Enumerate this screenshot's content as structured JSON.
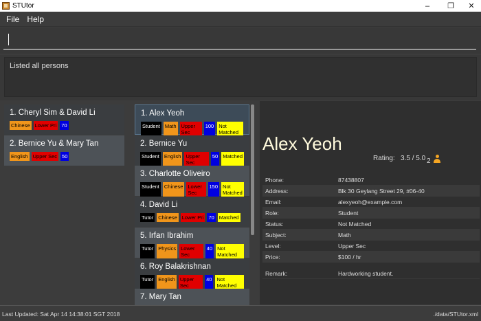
{
  "window": {
    "title": "STUtor",
    "min": "–",
    "max": "❐",
    "close": "✕"
  },
  "menu": {
    "file": "File",
    "help": "Help"
  },
  "command": {
    "value": "",
    "placeholder": ""
  },
  "result": {
    "text": "Listed all persons"
  },
  "matches": [
    {
      "index": "1.",
      "name": "Cheryl Sim & David Li",
      "tags": [
        {
          "text": "Chinese",
          "bg": "#f0951b",
          "fg": "#000"
        },
        {
          "text": "Lower Pri",
          "bg": "#e00000",
          "fg": "#000"
        },
        {
          "text": "70",
          "bg": "#0000e0",
          "fg": "#fff"
        }
      ]
    },
    {
      "index": "2.",
      "name": "Bernice Yu & Mary Tan",
      "tags": [
        {
          "text": "English",
          "bg": "#f0951b",
          "fg": "#000"
        },
        {
          "text": "Upper Sec",
          "bg": "#e00000",
          "fg": "#000"
        },
        {
          "text": "50",
          "bg": "#0000e0",
          "fg": "#fff"
        }
      ]
    }
  ],
  "persons": [
    {
      "index": "1.",
      "name": "Alex Yeoh",
      "tags": [
        {
          "text": "Student",
          "bg": "#000",
          "fg": "#fff"
        },
        {
          "text": "Math",
          "bg": "#f0951b",
          "fg": "#000"
        },
        {
          "text": "Upper Sec",
          "bg": "#e00000",
          "fg": "#000"
        },
        {
          "text": "100",
          "bg": "#0000e0",
          "fg": "#fff"
        },
        {
          "text": "Not Matched",
          "bg": "#ffff00",
          "fg": "#000"
        }
      ]
    },
    {
      "index": "2.",
      "name": "Bernice Yu",
      "tags": [
        {
          "text": "Student",
          "bg": "#000",
          "fg": "#fff"
        },
        {
          "text": "English",
          "bg": "#f0951b",
          "fg": "#000"
        },
        {
          "text": "Upper Sec",
          "bg": "#e00000",
          "fg": "#000"
        },
        {
          "text": "50",
          "bg": "#0000e0",
          "fg": "#fff"
        },
        {
          "text": "Matched",
          "bg": "#ffff00",
          "fg": "#000"
        }
      ]
    },
    {
      "index": "3.",
      "name": "Charlotte Oliveiro",
      "tags": [
        {
          "text": "Student",
          "bg": "#000",
          "fg": "#fff"
        },
        {
          "text": "Chinese",
          "bg": "#f0951b",
          "fg": "#000"
        },
        {
          "text": "Lower Sec",
          "bg": "#e00000",
          "fg": "#000"
        },
        {
          "text": "150",
          "bg": "#0000e0",
          "fg": "#fff"
        },
        {
          "text": "Not Matched",
          "bg": "#ffff00",
          "fg": "#000"
        }
      ]
    },
    {
      "index": "4.",
      "name": "David Li",
      "tags": [
        {
          "text": "Tutor",
          "bg": "#000",
          "fg": "#fff"
        },
        {
          "text": "Chinese",
          "bg": "#f0951b",
          "fg": "#000"
        },
        {
          "text": "Lower Pri",
          "bg": "#e00000",
          "fg": "#000"
        },
        {
          "text": "70",
          "bg": "#0000e0",
          "fg": "#fff"
        },
        {
          "text": "Matched",
          "bg": "#ffff00",
          "fg": "#000"
        }
      ]
    },
    {
      "index": "5.",
      "name": "Irfan Ibrahim",
      "tags": [
        {
          "text": "Tutor",
          "bg": "#000",
          "fg": "#fff"
        },
        {
          "text": "Physics",
          "bg": "#f0951b",
          "fg": "#000"
        },
        {
          "text": "Lower Sec",
          "bg": "#e00000",
          "fg": "#000"
        },
        {
          "text": "40",
          "bg": "#0000e0",
          "fg": "#fff"
        },
        {
          "text": "Not Matched",
          "bg": "#ffff00",
          "fg": "#000"
        }
      ]
    },
    {
      "index": "6.",
      "name": "Roy Balakrishnan",
      "tags": [
        {
          "text": "Tutor",
          "bg": "#000",
          "fg": "#fff"
        },
        {
          "text": "English",
          "bg": "#f0951b",
          "fg": "#000"
        },
        {
          "text": "Upper Sec",
          "bg": "#e00000",
          "fg": "#000"
        },
        {
          "text": "40",
          "bg": "#0000e0",
          "fg": "#fff"
        },
        {
          "text": "Not Matched",
          "bg": "#ffff00",
          "fg": "#000"
        }
      ]
    },
    {
      "index": "7.",
      "name": "Mary Tan",
      "tags": []
    }
  ],
  "detail": {
    "name": "Alex Yeoh",
    "rating_label": "Rating:",
    "rating_value": "3.5 / 5.0",
    "rating_count": "2",
    "fields": [
      {
        "key": "Phone:",
        "value": "87438807"
      },
      {
        "key": "Address:",
        "value": "Blk 30 Geylang Street 29, #06-40"
      },
      {
        "key": "Email:",
        "value": "alexyeoh@example.com"
      },
      {
        "key": "Role:",
        "value": "Student"
      },
      {
        "key": "Status:",
        "value": "Not Matched"
      },
      {
        "key": "Subject:",
        "value": "Math"
      },
      {
        "key": "Level:",
        "value": "Upper Sec"
      },
      {
        "key": "Price:",
        "value": "$100 / hr"
      }
    ],
    "remark_key": "Remark:",
    "remark_value": "Hardworking student."
  },
  "status": {
    "left": "Last Updated: Sat Apr 14 14:38:01 SGT 2018",
    "right": "./data/STUtor.xml"
  },
  "colors": {
    "selected_card": "#3d4b58",
    "name_heading": "#fffadc",
    "person_icon": "#f5a623"
  }
}
